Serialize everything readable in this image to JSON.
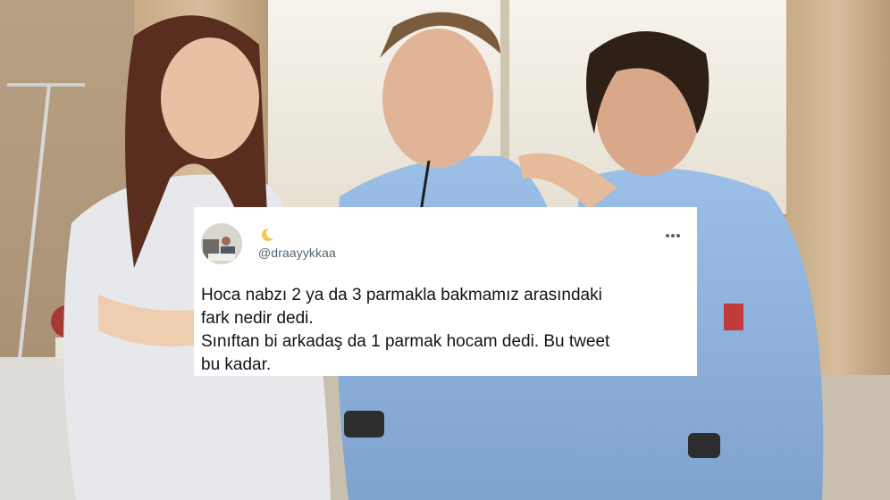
{
  "tweet": {
    "handle": "@draayykkaa",
    "text_lines": [
      "Hoca nabzı 2 ya da 3 parmakla bakmamız arasındaki",
      "fark nedir dedi.",
      "Sınıftan bi arkadaş da 1 parmak hocam dedi. Bu tweet",
      "bu kadar."
    ],
    "icons": {
      "avatar": "avatar",
      "name_emoji": "crescent-moon-icon",
      "menu": "more-options-icon"
    }
  },
  "colors": {
    "card": "#ffffff",
    "text": "#0f1419",
    "handle": "#536471",
    "scrub": "#8fb2dc"
  }
}
